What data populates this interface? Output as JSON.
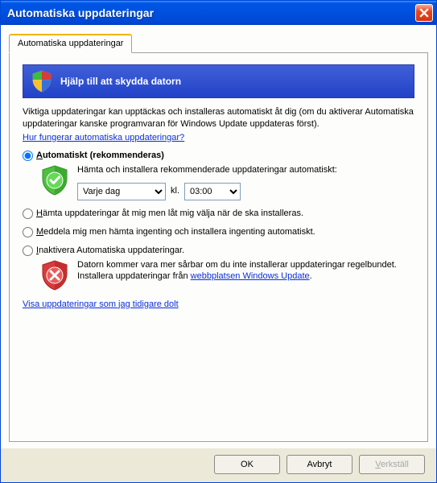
{
  "window": {
    "title": "Automatiska uppdateringar"
  },
  "tab": {
    "label": "Automatiska uppdateringar"
  },
  "banner": {
    "text": "Hjälp till att skydda datorn"
  },
  "description": "Viktiga uppdateringar kan upptäckas och installeras automatiskt åt dig (om du aktiverar Automatiska uppdateringar kanske programvaran för Windows Update uppdateras först).",
  "howitworks_link": "Hur fungerar automatiska uppdateringar?",
  "options": {
    "auto": {
      "pre": "A",
      "post": "utomatiskt (rekommenderas)",
      "desc": "Hämta och installera rekommenderade uppdateringar automatiskt:",
      "schedule": {
        "day": "Varje dag",
        "kl": "kl.",
        "time": "03:00"
      }
    },
    "download_only": {
      "pre": "H",
      "post": "ämta uppdateringar åt mig men låt mig välja när de ska installeras."
    },
    "notify_only": {
      "pre": "M",
      "post": "eddela mig men hämta ingenting och installera ingenting automatiskt."
    },
    "disable": {
      "pre": "I",
      "post": "naktivera Automatiska uppdateringar.",
      "warn1": "Datorn kommer vara mer sårbar om du inte installerar uppdateringar regelbundet.",
      "warn2_pre": "Installera uppdateringar från ",
      "warn2_link": "webbplatsen Windows Update",
      "warn2_post": "."
    }
  },
  "hidden_updates_link": "Visa uppdateringar som jag tidigare dolt",
  "buttons": {
    "ok": "OK",
    "cancel": "Avbryt",
    "apply_pre": "V",
    "apply_post": "erkställ"
  }
}
